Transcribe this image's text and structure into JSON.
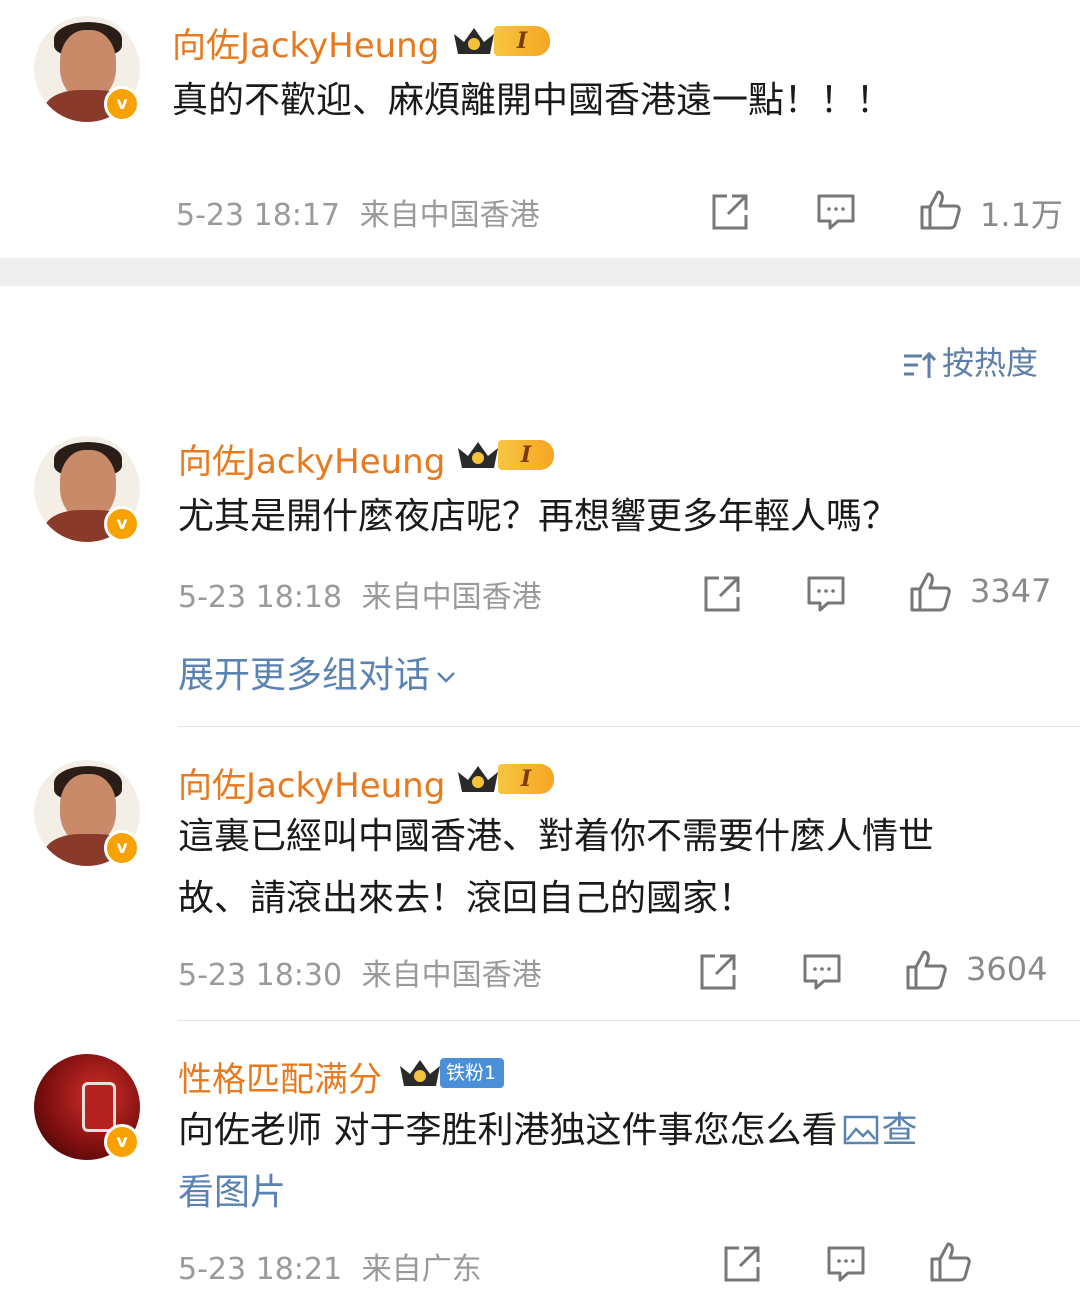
{
  "sort_label": "按热度",
  "expand_label": "展开更多组对话",
  "comments": [
    {
      "user": "向佐JackyHeung",
      "level": "I",
      "text_lines": [
        "真的不歡迎、麻煩離開中國香港遠一點！！！"
      ],
      "time": "5-23 18:17",
      "location": "来自中国香港",
      "likes": "1.1万"
    },
    {
      "user": "向佐JackyHeung",
      "level": "I",
      "text_lines": [
        "尤其是開什麼夜店呢？再想響更多年輕人嗎？"
      ],
      "time": "5-23 18:18",
      "location": "来自中国香港",
      "likes": "3347"
    },
    {
      "user": "向佐JackyHeung",
      "level": "I",
      "text_lines": [
        "這裏已經叫中國香港、對着你不需要什麼人情世",
        "故、請滾出來去！滾回自己的國家！"
      ],
      "time": "5-23 18:30",
      "location": "来自中国香港",
      "likes": "3604"
    },
    {
      "user": "性格匹配满分",
      "fan_badge": "铁粉1",
      "text_lines": [
        "向佐老师 对于李胜利港独这件事您怎么看",
        "看图片"
      ],
      "link_label": "查",
      "time": "5-23 18:21",
      "location": "来自广东",
      "likes": ""
    }
  ],
  "colors": {
    "name": "#e8791c",
    "link": "#5a83b3",
    "meta": "#9a9a9a",
    "verify": "#f7a200"
  }
}
